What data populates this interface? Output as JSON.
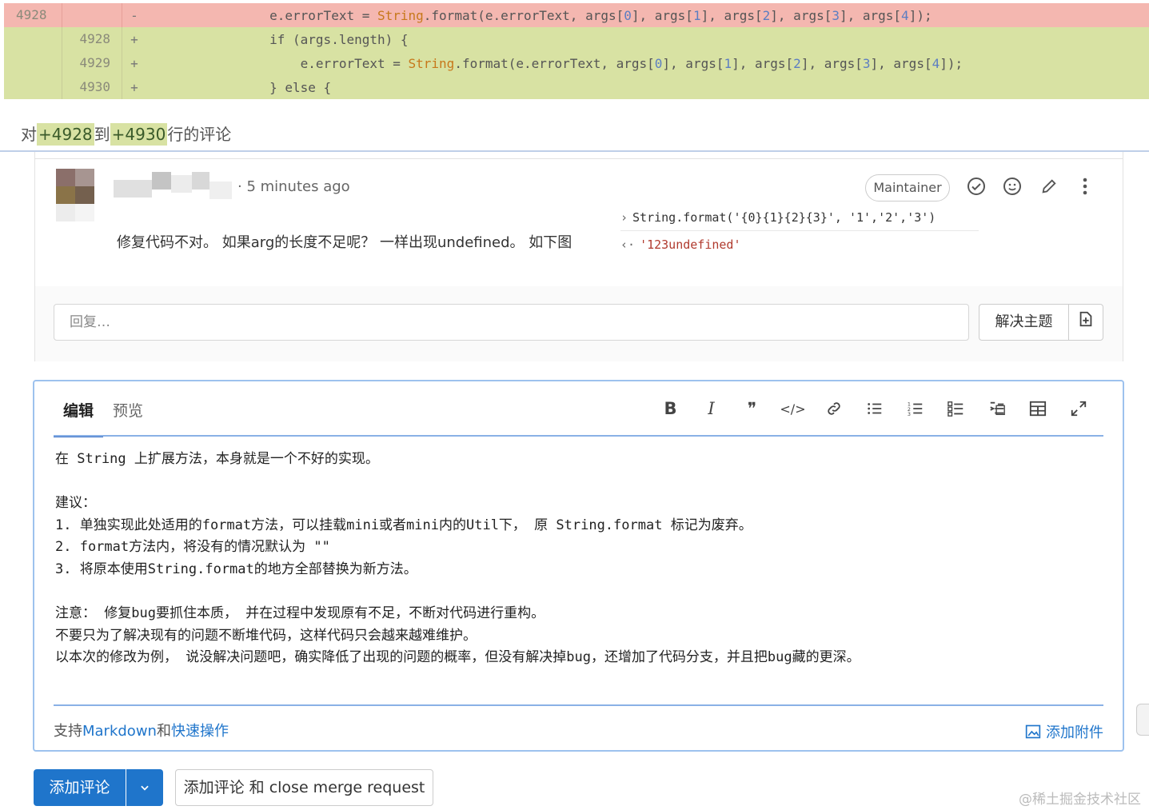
{
  "diff": {
    "rows": [
      {
        "type": "del",
        "old": "4928",
        "new": "",
        "sign": "-",
        "indent": "                ",
        "pre": "e.errorText = ",
        "str": "String",
        "post": ".format(e.errorText, args[",
        "a0": "0",
        "b0": "], args[",
        "a1": "1",
        "b1": "], args[",
        "a2": "2",
        "b2": "], args[",
        "a3": "3",
        "b3": "], args[",
        "a4": "4",
        "b4": "]);"
      },
      {
        "type": "add",
        "old": "",
        "new": "4928",
        "sign": "+",
        "text": "                if (args.length) {"
      },
      {
        "type": "add",
        "old": "",
        "new": "4929",
        "sign": "+",
        "indent": "                    ",
        "pre": "e.errorText = ",
        "str": "String",
        "post": ".format(e.errorText, args[",
        "a0": "0",
        "b0": "], args[",
        "a1": "1",
        "b1": "], args[",
        "a2": "2",
        "b2": "], args[",
        "a3": "3",
        "b3": "], args[",
        "a4": "4",
        "b4": "]);"
      },
      {
        "type": "add",
        "old": "",
        "new": "4930",
        "sign": "+",
        "text": "                } else {"
      }
    ]
  },
  "comment_on": {
    "prefix": "对",
    "from": "+4928",
    "mid": "到",
    "to": "+4930",
    "suffix": "行的评论"
  },
  "thread": {
    "time": "· 5 minutes ago",
    "badge": "Maintainer",
    "body": "修复代码不对。 如果arg的长度不足呢？ 一样出现undefined。 如下图",
    "console_in": "String.format('{0}{1}{2}{3}', '1','2','3')",
    "console_out": "'123undefined'",
    "reply_placeholder": "回复…",
    "resolve_label": "解决主题"
  },
  "editor": {
    "tab_edit": "编辑",
    "tab_preview": "预览",
    "lines": [
      "在 String 上扩展方法，本身就是一个不好的实现。",
      "",
      "建议：",
      "1. 单独实现此处适用的format方法，可以挂载mini或者mini内的Util下， 原 String.format 标记为废弃。",
      "2. format方法内，将没有的情况默认为 \"\"",
      "3. 将原本使用String.format的地方全部替换为新方法。",
      "",
      "注意： 修复bug要抓住本质， 并在过程中发现原有不足，不断对代码进行重构。",
      "不要只为了解决现有的问题不断堆代码，这样代码只会越来越难维护。",
      "以本次的修改为例， 说没解决问题吧，确实降低了出现的问题的概率，但没有解决掉bug，还增加了代码分支，并且把bug藏的更深。"
    ],
    "footer_prefix": "支持",
    "footer_md": "Markdown",
    "footer_and": "和",
    "footer_quick": "快速操作",
    "attach": "添加附件"
  },
  "buttons": {
    "add_comment": "添加评论",
    "add_close": "添加评论 和 close merge request"
  },
  "watermark": "@稀土掘金技术社区",
  "icons": {
    "bold": "B",
    "italic": "I",
    "quote": "❞",
    "code": "</>",
    "link": "🔗",
    "bullets": "☰",
    "numbered": "☷",
    "task": "☑",
    "indent": "⇥",
    "table": "▦",
    "fullscreen": "⤢"
  }
}
